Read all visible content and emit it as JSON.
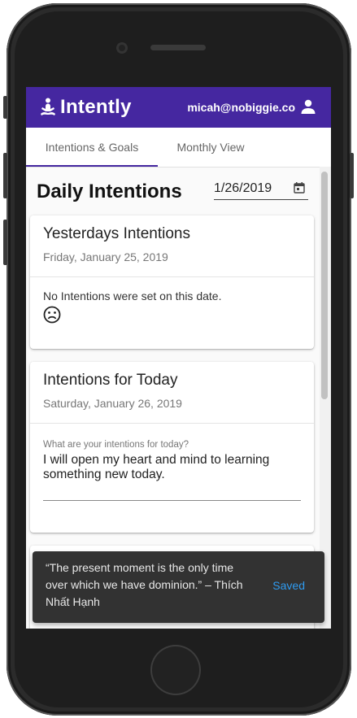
{
  "app": {
    "title": "Intently",
    "user_email": "micah@nobiggie.co"
  },
  "tabs": [
    {
      "label": "Intentions & Goals",
      "active": true
    },
    {
      "label": "Monthly View",
      "active": false
    }
  ],
  "page": {
    "title": "Daily Intentions",
    "date_value": "1/26/2019"
  },
  "yesterday_card": {
    "title": "Yesterdays Intentions",
    "date": "Friday, January 25, 2019",
    "empty_message": "No Intentions were set on this date."
  },
  "today_card": {
    "title": "Intentions for Today",
    "date": "Saturday, January 26, 2019",
    "field_label": "What are your intentions for today?",
    "field_value": "I will open my heart and mind to learning something new today."
  },
  "snackbar": {
    "message": "“The present moment is the only time over which we have dominion.” – Thích Nhất Hạnh",
    "action": "Saved"
  },
  "colors": {
    "brand": "#4527a0",
    "snackbar_bg": "#323232",
    "snackbar_action": "#2f9bf0"
  },
  "icons": {
    "logo": "meditation-icon",
    "user": "account-icon",
    "calendar": "calendar-icon",
    "empty": "sad-face-icon"
  }
}
